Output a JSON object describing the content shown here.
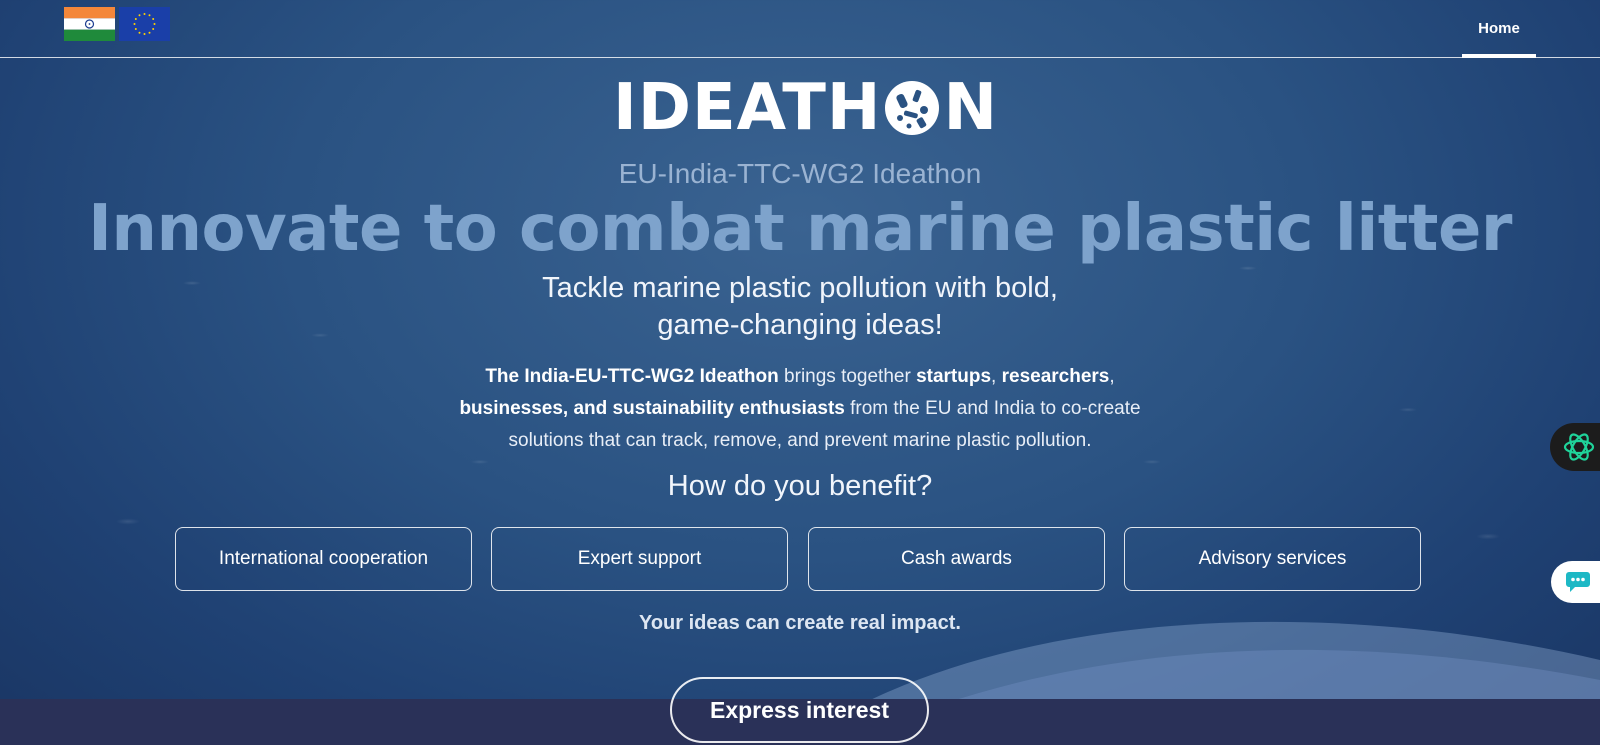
{
  "nav": {
    "home_label": "Home"
  },
  "logo": {
    "text_before": "IDEATH",
    "text_after": "N"
  },
  "hero": {
    "subtitle": "EU-India-TTC-WG2 Ideathon",
    "headline": "Innovate to combat marine plastic litter",
    "tagline_line1": "Tackle marine plastic pollution with bold,",
    "tagline_line2": "game-changing ideas!"
  },
  "intro": {
    "bold1": "The India-EU-TTC-WG2 Ideathon",
    "text1": " brings together ",
    "bold2": "startups",
    "text2": ", ",
    "bold3": "researchers",
    "text3": ", ",
    "bold4": "businesses, and sustainability enthusiasts",
    "text4": " from the EU and India to co-create solutions that can track, remove, and prevent marine plastic pollution."
  },
  "benefits": {
    "title": "How do you benefit?",
    "items": [
      {
        "label": "International cooperation"
      },
      {
        "label": "Expert support"
      },
      {
        "label": "Cash awards"
      },
      {
        "label": "Advisory services"
      }
    ],
    "impact": "Your ideas can create real impact."
  },
  "cta": {
    "label": "Express interest"
  },
  "icons": {
    "india_flag": "india-flag-icon",
    "eu_flag": "eu-flag-icon",
    "ai_assistant": "ai-assistant-icon",
    "chat": "chat-icon"
  },
  "colors": {
    "background": "#2a5282",
    "headline": "#7ea3cc",
    "subtitle": "#9ab3d2",
    "bottom_band": "#2a3158",
    "ai_widget_accent": "#1fd39a"
  }
}
